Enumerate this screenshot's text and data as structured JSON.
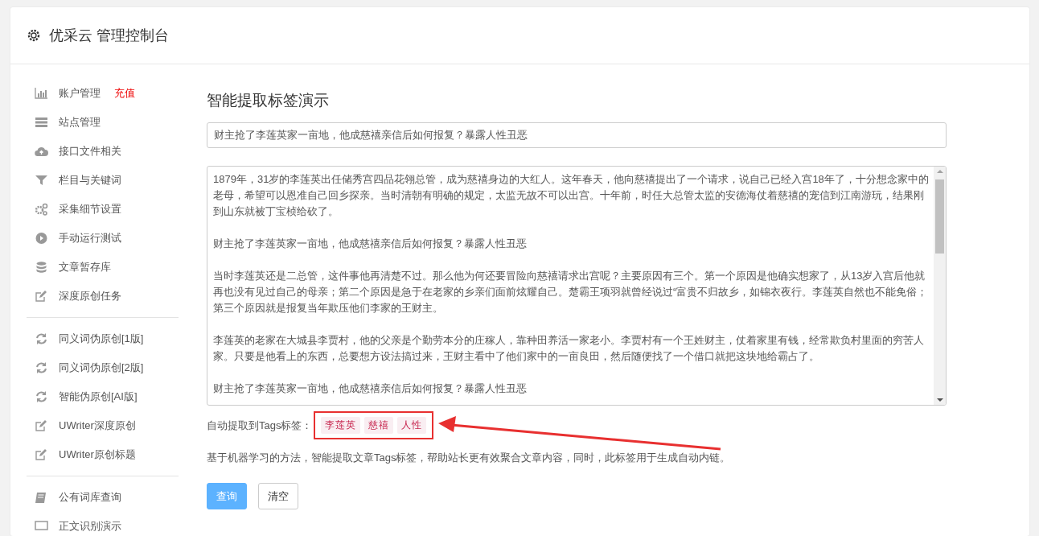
{
  "header": {
    "title": "优采云 管理控制台"
  },
  "sidebar": {
    "groups": [
      {
        "items": [
          {
            "label": "账户管理",
            "badge": "充值"
          },
          {
            "label": "站点管理"
          },
          {
            "label": "接口文件相关"
          },
          {
            "label": "栏目与关键词"
          },
          {
            "label": "采集细节设置"
          },
          {
            "label": "手动运行测试"
          },
          {
            "label": "文章暂存库"
          },
          {
            "label": "深度原创任务"
          }
        ]
      },
      {
        "items": [
          {
            "label": "同义词伪原创[1版]"
          },
          {
            "label": "同义词伪原创[2版]"
          },
          {
            "label": "智能伪原创[AI版]"
          },
          {
            "label": "UWriter深度原创"
          },
          {
            "label": "UWriter原创标题"
          }
        ]
      },
      {
        "items": [
          {
            "label": "公有词库查询"
          },
          {
            "label": "正文识别演示"
          }
        ]
      }
    ]
  },
  "main": {
    "heading": "智能提取标签演示",
    "title_field": {
      "value": "财主抢了李莲英家一亩地，他成慈禧亲信后如何报复？暴露人性丑恶"
    },
    "content_paragraphs": [
      "1879年，31岁的李莲英出任储秀宫四品花翎总管，成为慈禧身边的大红人。这年春天，他向慈禧提出了一个请求，说自己已经入宫18年了，十分想念家中的老母，希望可以恩准自己回乡探亲。当时清朝有明确的规定，太监无故不可以出宫。十年前，时任大总管太监的安德海仗着慈禧的宠信到江南游玩，结果刚到山东就被丁宝桢给砍了。",
      "财主抢了李莲英家一亩地，他成慈禧亲信后如何报复？暴露人性丑恶",
      "当时李莲英还是二总管，这件事他再清楚不过。那么他为何还要冒险向慈禧请求出宫呢？主要原因有三个。第一个原因是他确实想家了，从13岁入宫后他就再也没有见过自己的母亲；第二个原因是急于在老家的乡亲们面前炫耀自己。楚霸王项羽就曾经说过“富贵不归故乡，如锦衣夜行。李莲英自然也不能免俗；第三个原因就是报复当年欺压他们李家的王财主。",
      "李莲英的老家在大城县李贾村，他的父亲是个勤劳本分的庄稼人，靠种田养活一家老小。李贾村有一个王姓财主，仗着家里有钱，经常欺负村里面的穷苦人家。只要是他看上的东西，总要想方设法搞过来，王财主看中了他们家中的一亩良田，然后随便找了一个借口就把这块地给霸占了。",
      "财主抢了李莲英家一亩地，他成慈禧亲信后如何报复？暴露人性丑恶"
    ],
    "tags_label": "自动提取到Tags标签：",
    "tags": [
      "李莲英",
      "慈禧",
      "人性"
    ],
    "description": "基于机器学习的方法，智能提取文章Tags标签，帮助站长更有效聚合文章内容，同时，此标签用于生成自动内链。",
    "buttons": [
      {
        "label": "查询",
        "kind": "primary"
      },
      {
        "label": "清空",
        "kind": "default"
      }
    ]
  }
}
